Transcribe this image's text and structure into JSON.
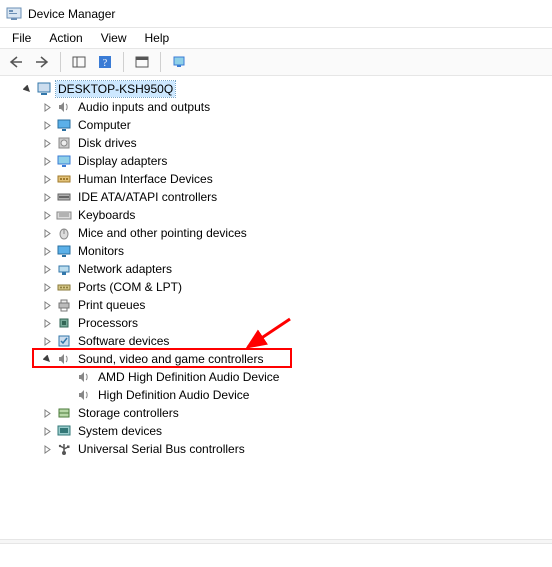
{
  "window": {
    "title": "Device Manager"
  },
  "menu": {
    "file": "File",
    "action": "Action",
    "view": "View",
    "help": "Help"
  },
  "tree": {
    "root": "DESKTOP-KSH950Q",
    "categories": [
      {
        "label": "Audio inputs and outputs",
        "icon": "speaker"
      },
      {
        "label": "Computer",
        "icon": "monitor"
      },
      {
        "label": "Disk drives",
        "icon": "disk"
      },
      {
        "label": "Display adapters",
        "icon": "display"
      },
      {
        "label": "Human Interface Devices",
        "icon": "hid"
      },
      {
        "label": "IDE ATA/ATAPI controllers",
        "icon": "ide"
      },
      {
        "label": "Keyboards",
        "icon": "keyboard"
      },
      {
        "label": "Mice and other pointing devices",
        "icon": "mouse"
      },
      {
        "label": "Monitors",
        "icon": "monitor"
      },
      {
        "label": "Network adapters",
        "icon": "network"
      },
      {
        "label": "Ports (COM & LPT)",
        "icon": "port"
      },
      {
        "label": "Print queues",
        "icon": "printer"
      },
      {
        "label": "Processors",
        "icon": "cpu"
      },
      {
        "label": "Software devices",
        "icon": "software"
      },
      {
        "label": "Sound, video and game controllers",
        "icon": "speaker",
        "expanded": true,
        "children": [
          {
            "label": "AMD High Definition Audio Device",
            "icon": "speaker"
          },
          {
            "label": "High Definition Audio Device",
            "icon": "speaker"
          }
        ]
      },
      {
        "label": "Storage controllers",
        "icon": "storage"
      },
      {
        "label": "System devices",
        "icon": "system"
      },
      {
        "label": "Universal Serial Bus controllers",
        "icon": "usb"
      }
    ]
  },
  "annotations": {
    "highlighted_category": "Sound, video and game controllers"
  }
}
